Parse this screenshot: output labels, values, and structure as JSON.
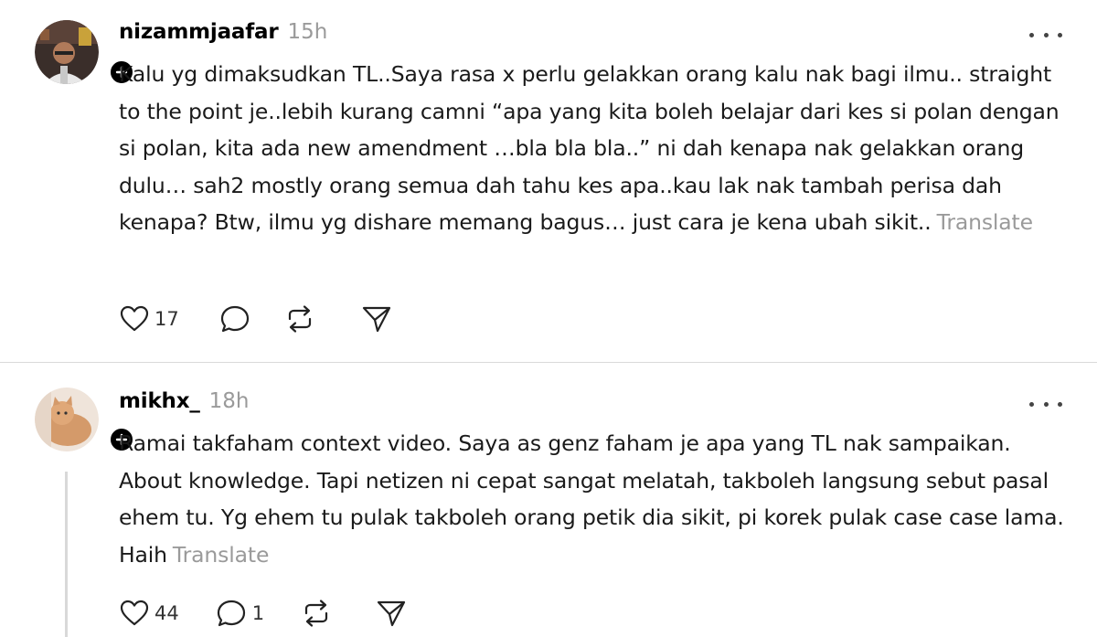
{
  "posts": [
    {
      "username": "nizammjaafar",
      "time": "15h",
      "text": "Kalu yg dimaksudkan TL..Saya rasa x perlu gelakkan orang kalu nak bagi ilmu.. straight to the point je..lebih kurang camni “apa yang kita boleh belajar dari kes si polan dengan si polan, kita ada new amendment …bla bla bla..” ni dah kenapa nak gelakkan orang dulu… sah2 mostly orang semua dah tahu kes apa..kau lak nak tambah perisa dah kenapa? Btw, ilmu yg dishare memang bagus… just cara je kena ubah sikit..",
      "translate_label": "Translate",
      "likes": "17",
      "replies": "",
      "icons": [
        "heart-icon",
        "comment-icon",
        "repost-icon",
        "share-icon"
      ]
    },
    {
      "username": "mikhx_",
      "time": "18h",
      "text": "Ramai takfaham context video. Saya as genz faham je apa yang TL nak sampaikan. About knowledge. Tapi netizen ni cepat sangat melatah, takboleh langsung sebut pasal ehem tu. Yg ehem tu pulak takboleh orang petik dia sikit, pi korek pulak case case lama. Haih",
      "translate_label": "Translate",
      "likes": "44",
      "replies": "1",
      "icons": [
        "heart-icon",
        "comment-icon",
        "repost-icon",
        "share-icon"
      ]
    }
  ],
  "colors": {
    "text": "#1a1a1a",
    "muted": "#9a9a9a",
    "divider": "#d9d9d9",
    "badge": "#000000"
  }
}
